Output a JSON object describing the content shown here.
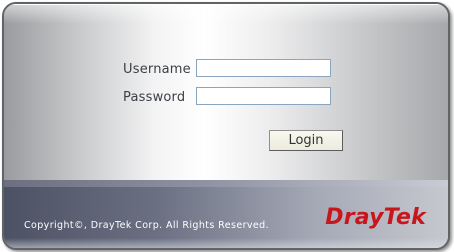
{
  "login_form": {
    "username_label": "Username",
    "username_value": "",
    "password_label": "Password",
    "password_value": "",
    "login_button": "Login"
  },
  "footer": {
    "copyright": "Copyright©, DrayTek Corp. All Rights Reserved.",
    "logo_part1": "Dray",
    "logo_part2": "Tek"
  },
  "colors": {
    "logo_red": "#c8161d",
    "field_border": "#8aa6bf",
    "footer_dark": "#4c5263"
  }
}
